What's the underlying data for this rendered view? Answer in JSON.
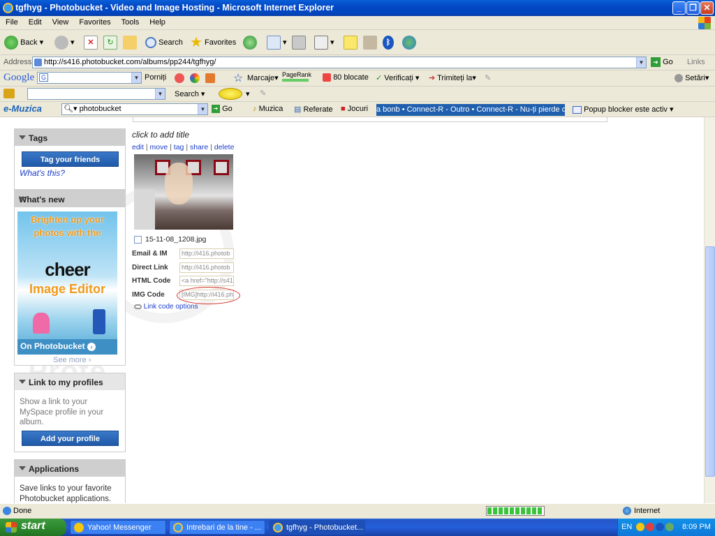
{
  "window": {
    "title": "tgfhyg - Photobucket - Video and Image Hosting - Microsoft Internet Explorer"
  },
  "menu": [
    "File",
    "Edit",
    "View",
    "Favorites",
    "Tools",
    "Help"
  ],
  "toolbar": {
    "back": "Back",
    "search": "Search",
    "favorites": "Favorites"
  },
  "address": {
    "label": "Address",
    "url": "http://s416.photobucket.com/albums/pp244/tgfhyg/",
    "go": "Go",
    "links": "Links"
  },
  "googlebar": {
    "logo": "Google",
    "porniti": "Porniți",
    "marcaje": "Marcaje",
    "pagerank": "PageRank",
    "blocked": "80 blocate",
    "verificati": "Verificați",
    "trimiteti": "Trimiteți la",
    "setari": "Setări"
  },
  "searchbar": {
    "search": "Search"
  },
  "emuzica": {
    "logo": "e-Muzica",
    "query": "photobucket",
    "go": "Go",
    "muzica": "Muzica",
    "referate": "Referate",
    "jocuri": "Jocuri",
    "ticker": "a bonb • Connect-R - Outro • Connect-R - Nu-ți pierde d",
    "popup": "Popup blocker este activ"
  },
  "sidebar": {
    "tags": {
      "title": "Tags",
      "button": "Tag your friends",
      "whats_this": "What's this?"
    },
    "whats_new": {
      "title": "What's new",
      "ad_line1": "Brighten up your",
      "ad_line2": "photos with the",
      "ad_brand": "cheer",
      "ad_product": "Image Editor",
      "ad_footer": "On Photobucket",
      "see_more": "See more"
    },
    "link_profiles": {
      "title": "Link to my profiles",
      "text": "Show a link to your MySpace profile in your album.",
      "button": "Add your profile"
    },
    "applications": {
      "title": "Applications",
      "text": "Save links to your favorite Photobucket applications."
    }
  },
  "photo": {
    "title_placeholder": "click to add title",
    "actions": [
      "edit",
      "move",
      "tag",
      "share",
      "delete"
    ],
    "filename": "15-11-08_1208.jpg",
    "codes": [
      {
        "label": "Email & IM",
        "value": "http://i416.photob"
      },
      {
        "label": "Direct Link",
        "value": "http://i416.photob"
      },
      {
        "label": "HTML Code",
        "value": "<a href=\"http://s41"
      },
      {
        "label": "IMG Code",
        "value": "[IMG]http://i416.ph"
      }
    ],
    "link_options": "Link code options"
  },
  "watermark": "Prote",
  "statusbar": {
    "status": "Done",
    "zone": "Internet",
    "progress": 1.0
  },
  "taskbar": {
    "start": "start",
    "tasks": [
      "Yahoo! Messenger",
      "Intrebari de la tine - ...",
      "tgfhyg - Photobucket..."
    ],
    "lang": "EN",
    "clock": "8:09 PM"
  }
}
